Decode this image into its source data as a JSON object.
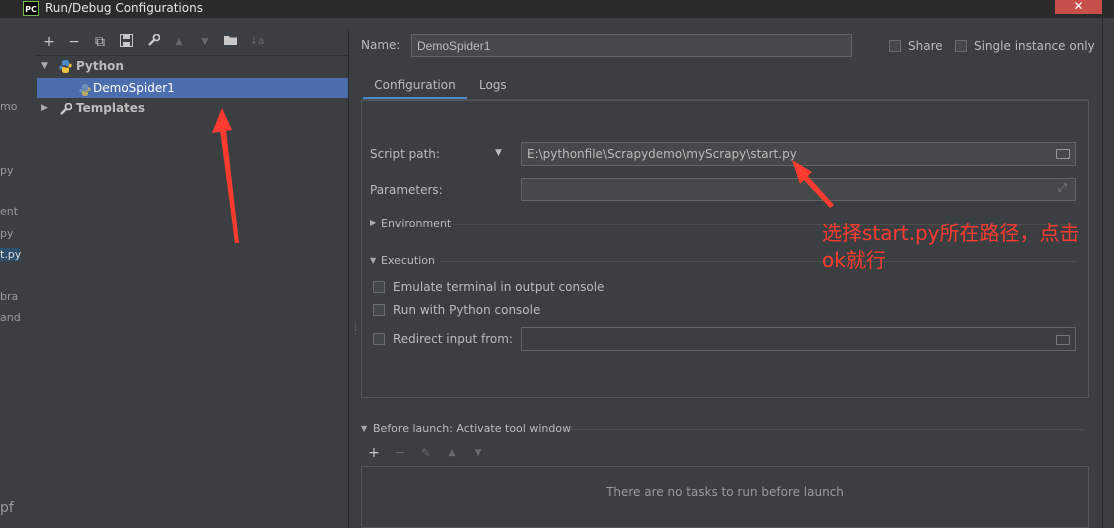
{
  "window": {
    "title": "Run/Debug Configurations",
    "app_icon_text": "PC",
    "close_label": "✕"
  },
  "background_ide": {
    "fragments": [
      "mo",
      "py",
      "ent",
      "py",
      "t.py",
      "bra",
      "and",
      "pf"
    ]
  },
  "toolbar": {
    "add": "+",
    "remove": "−",
    "copy": "⧉",
    "save": "💾",
    "edit_defaults": "🔧",
    "move_up": "▲",
    "move_down": "▼",
    "new_folder": "📁",
    "sort": "↓a"
  },
  "tree": {
    "python_label": "Python",
    "config_label": "DemoSpider1",
    "templates_label": "Templates"
  },
  "form": {
    "name_label": "Name:",
    "name_value": "DemoSpider1",
    "share_label": "Share",
    "single_instance_label": "Single instance only",
    "tabs": [
      {
        "label": "Configuration"
      },
      {
        "label": "Logs"
      }
    ],
    "script_path_label": "Script path:",
    "script_path_value": "E:\\pythonfile\\Scrapydemo\\myScrapy\\start.py",
    "parameters_label": "Parameters:",
    "parameters_value": "",
    "environment_label": "Environment",
    "execution_label": "Execution",
    "emulate_terminal_label": "Emulate terminal in output console",
    "run_python_console_label": "Run with Python console",
    "redirect_input_label": "Redirect input from:",
    "redirect_input_value": ""
  },
  "before_launch": {
    "header": "Before launch: Activate tool window",
    "empty_text": "There are no tasks to run before launch"
  },
  "annotation": {
    "text_line1": "选择start.py所在路径，点击",
    "text_line2": "ok就行",
    "color": "#ff3b2f"
  },
  "colors": {
    "selection": "#4b6eaf",
    "panel": "#3c3f41",
    "accent_tab": "#4a88c7",
    "close": "#c7504b"
  }
}
